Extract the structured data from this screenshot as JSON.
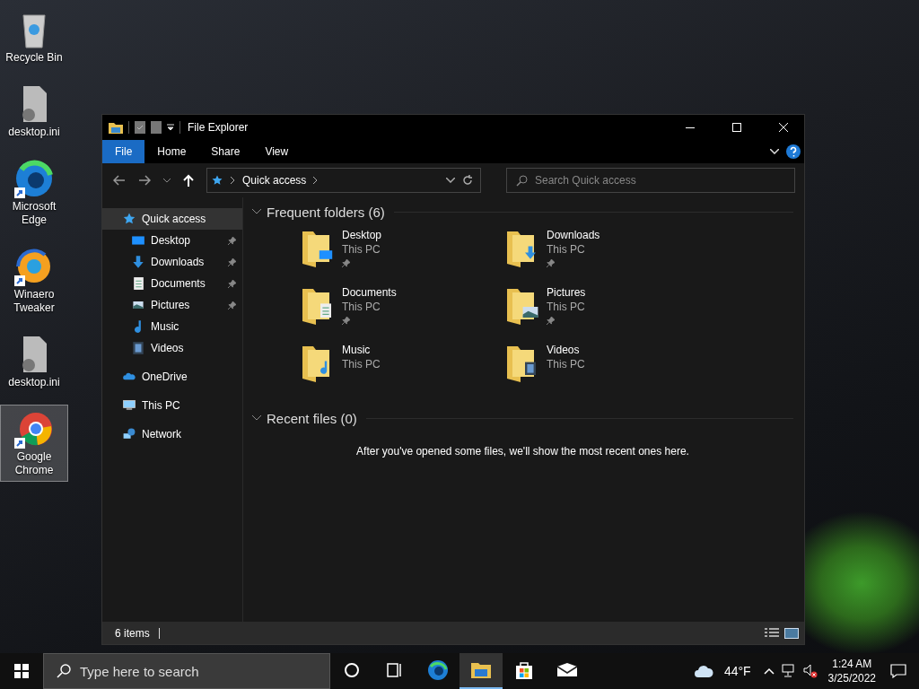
{
  "desktop_icons": [
    {
      "label": "Recycle Bin",
      "kind": "recycle",
      "selected": false
    },
    {
      "label": "desktop.ini",
      "kind": "ini",
      "selected": false
    },
    {
      "label": "Microsoft Edge",
      "kind": "edge",
      "selected": false
    },
    {
      "label": "Winaero Tweaker",
      "kind": "winaero",
      "selected": false
    },
    {
      "label": "desktop.ini",
      "kind": "ini",
      "selected": false
    },
    {
      "label": "Google Chrome",
      "kind": "chrome",
      "selected": true
    }
  ],
  "window": {
    "title": "File Explorer",
    "ribbon_tabs": [
      {
        "label": "File",
        "selected": true
      },
      {
        "label": "Home",
        "selected": false
      },
      {
        "label": "Share",
        "selected": false
      },
      {
        "label": "View",
        "selected": false
      }
    ],
    "address": {
      "location": "Quick access"
    },
    "search": {
      "placeholder": "Search Quick access"
    },
    "navigation": [
      {
        "label": "Quick access",
        "kind": "star",
        "selected": true,
        "children": [
          {
            "label": "Desktop",
            "kind": "desktop",
            "pinned": true
          },
          {
            "label": "Downloads",
            "kind": "downloads",
            "pinned": true
          },
          {
            "label": "Documents",
            "kind": "documents",
            "pinned": true
          },
          {
            "label": "Pictures",
            "kind": "pictures",
            "pinned": true
          },
          {
            "label": "Music",
            "kind": "music",
            "pinned": false
          },
          {
            "label": "Videos",
            "kind": "videos",
            "pinned": false
          }
        ]
      },
      {
        "label": "OneDrive",
        "kind": "cloud",
        "selected": false
      },
      {
        "label": "This PC",
        "kind": "pc",
        "selected": false
      },
      {
        "label": "Network",
        "kind": "network",
        "selected": false
      }
    ],
    "frequent_folders": {
      "title": "Frequent folders (6)",
      "expanded": true,
      "items": [
        {
          "name": "Desktop",
          "location": "This PC",
          "kind": "desktop",
          "pinned": true
        },
        {
          "name": "Downloads",
          "location": "This PC",
          "kind": "downloads",
          "pinned": true
        },
        {
          "name": "Documents",
          "location": "This PC",
          "kind": "documents",
          "pinned": true
        },
        {
          "name": "Pictures",
          "location": "This PC",
          "kind": "pictures",
          "pinned": true
        },
        {
          "name": "Music",
          "location": "This PC",
          "kind": "music",
          "pinned": false
        },
        {
          "name": "Videos",
          "location": "This PC",
          "kind": "videos",
          "pinned": false
        }
      ]
    },
    "recent_files": {
      "title": "Recent files (0)",
      "expanded": true,
      "message": "After you've opened some files, we'll show the most recent ones here."
    },
    "status_bar": {
      "item_count": "6 items"
    }
  },
  "taskbar": {
    "search": {
      "placeholder": "Type here to search"
    },
    "apps": [
      {
        "kind": "cortana",
        "active": false
      },
      {
        "kind": "taskview",
        "active": false
      },
      {
        "kind": "edge",
        "active": false
      },
      {
        "kind": "explorer",
        "active": true
      },
      {
        "kind": "store",
        "active": false
      },
      {
        "kind": "mail",
        "active": false
      }
    ],
    "weather": "44°F",
    "time": "1:24 AM",
    "date": "3/25/2022"
  }
}
